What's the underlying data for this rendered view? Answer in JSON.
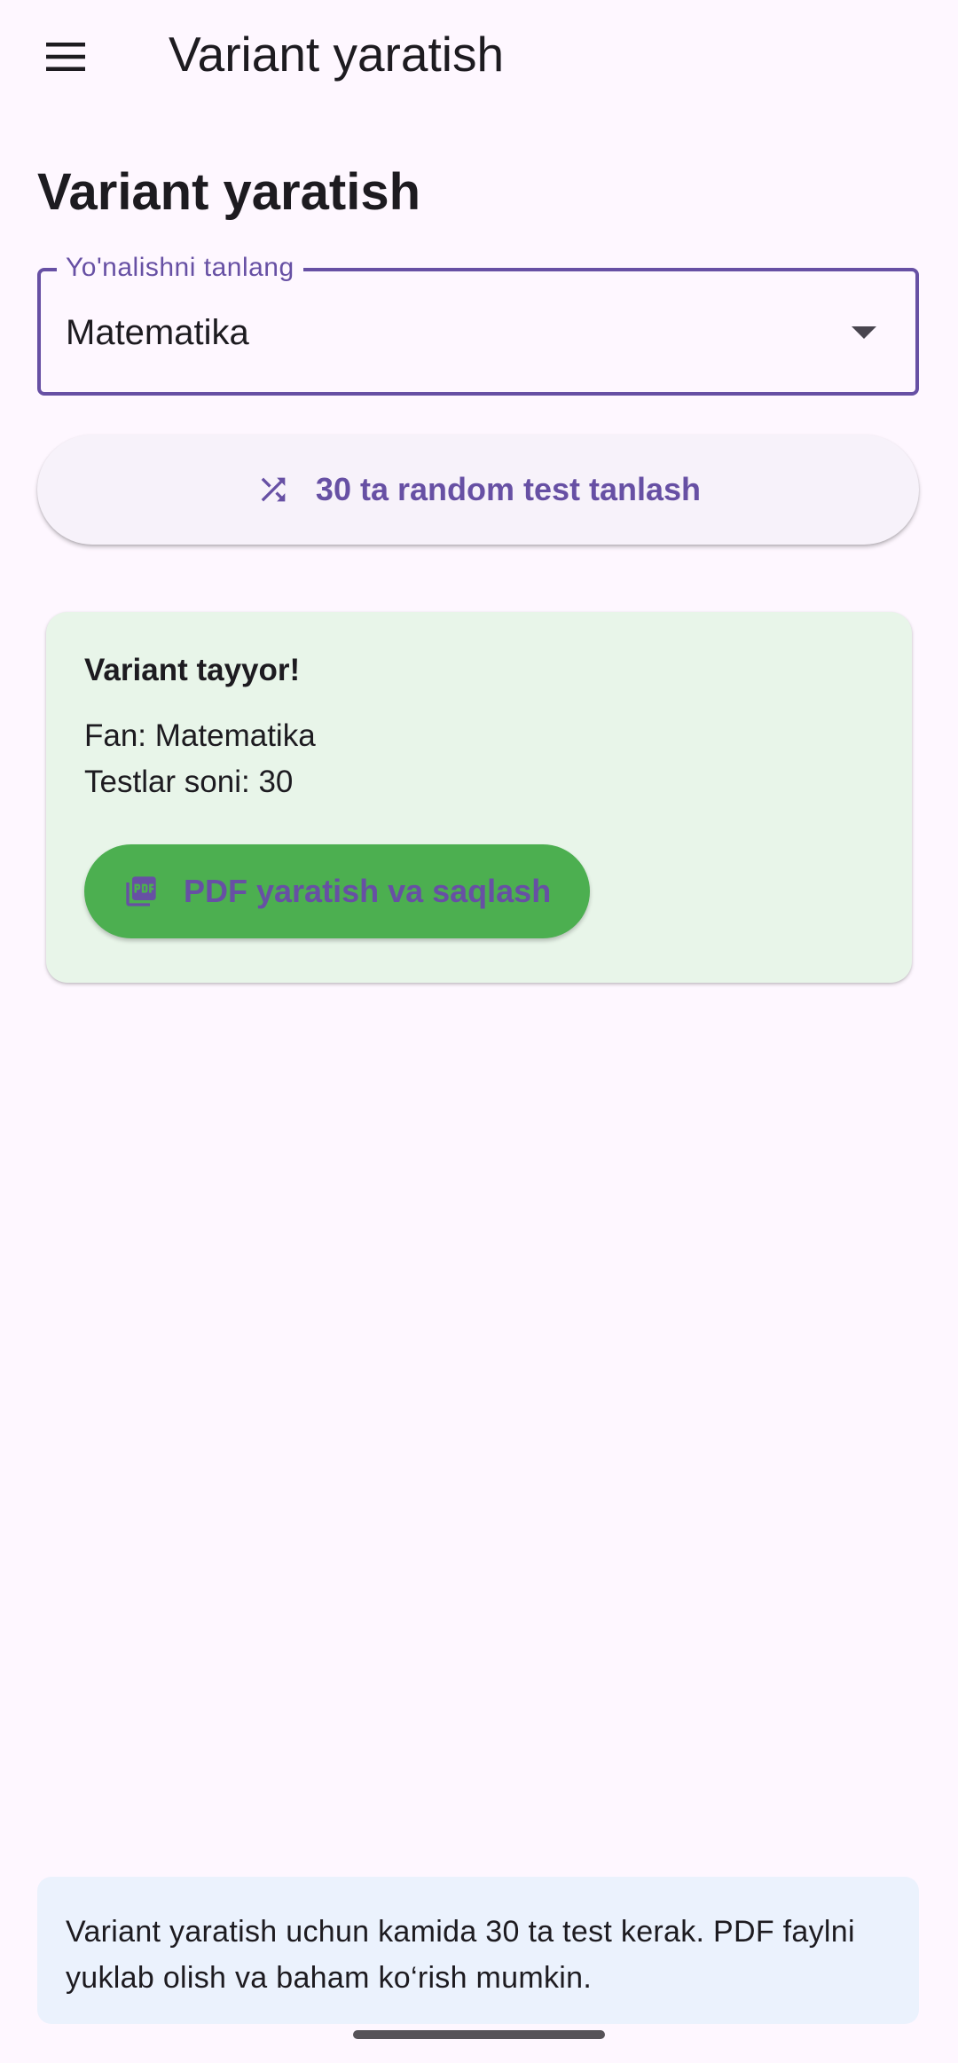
{
  "app_bar": {
    "title": "Variant yaratish",
    "menu_icon": "menu-icon"
  },
  "page": {
    "heading": "Variant yaratish"
  },
  "direction_select": {
    "label": "Yo'nalishni tanlang",
    "value": "Matematika",
    "arrow_icon": "dropdown-arrow-icon"
  },
  "random_button": {
    "icon": "shuffle-icon",
    "label": "30 ta random test tanlash"
  },
  "result_card": {
    "title": "Variant tayyor!",
    "subject_line": "Fan: Matematika",
    "count_line": "Testlar soni: 30",
    "pdf_button": {
      "icon": "pdf-icon",
      "label": "PDF yaratish va saqlash"
    }
  },
  "info": {
    "text": "Variant yaratish uchun kamida 30 ta test kerak. PDF faylni yuklab olish va baham ko‘rish mumkin."
  },
  "colors": {
    "background": "#fef7ff",
    "accent": "#6750a4",
    "card_green_bg": "#e8f5e9",
    "button_green": "#4caf50",
    "info_bg": "#ebf2fd"
  }
}
